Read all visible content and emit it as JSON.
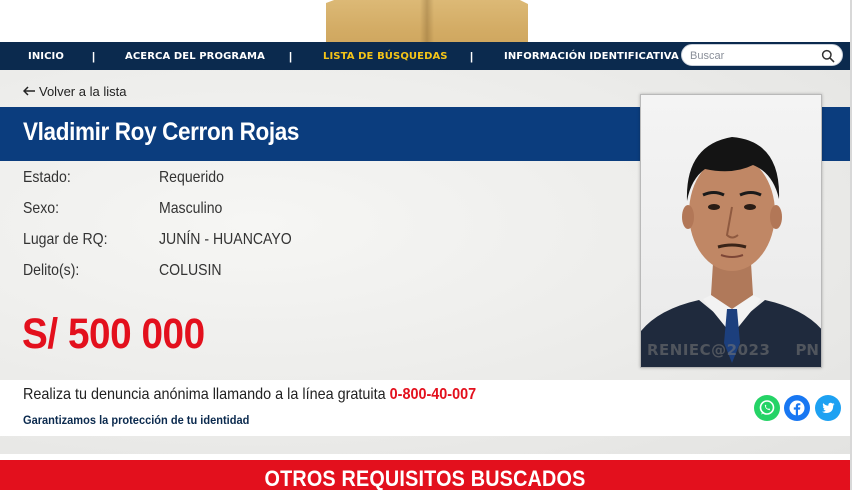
{
  "nav": {
    "items": [
      {
        "label": "INICIO"
      },
      {
        "label": "ACERCA DEL PROGRAMA"
      },
      {
        "label": "LISTA DE BÚSQUEDAS"
      },
      {
        "label": "INFORMACIÓN IDENTIFICATIVA"
      }
    ],
    "separator": "|",
    "active_item": "LISTA DE BÚSQUEDAS",
    "active_color": "#f5c518",
    "background_color": "#0b2a4e"
  },
  "search": {
    "placeholder": "Buscar",
    "value": "",
    "icon": "search-icon"
  },
  "back_link": {
    "label": "Volver a la lista",
    "icon": "arrow-left-icon"
  },
  "person": {
    "name": "Vladimir Roy Cerron Rojas",
    "fields": [
      {
        "label": "Estado:",
        "value": "Requerido"
      },
      {
        "label": "Sexo:",
        "value": "Masculino"
      },
      {
        "label": "Lugar de RQ:",
        "value": "JUNÍN - HUANCAYO"
      },
      {
        "label": "Delito(s):",
        "value": "COLUSIN"
      }
    ],
    "reward": "S/ 500 000",
    "photo_watermark": "RENIEC@2023",
    "photo_watermark_2": "PN"
  },
  "notice": {
    "text_before": "Realiza tu denuncia anónima llamando a la línea gratuita ",
    "hotline": "0-800-40-007",
    "subtext": "Garantizamos la protección de tu identidad"
  },
  "share": {
    "buttons": [
      {
        "name": "whatsapp",
        "color": "#25d366",
        "icon": "whatsapp-icon"
      },
      {
        "name": "facebook",
        "color": "#1877f2",
        "icon": "facebook-icon"
      },
      {
        "name": "twitter",
        "color": "#1da1f2",
        "icon": "twitter-icon"
      }
    ]
  },
  "footer": {
    "heading": "OTROS REQUISITOS BUSCADOS"
  },
  "colors": {
    "title_band": "#0b3d7e",
    "reward": "#e3101d",
    "footer_band": "#e3101d"
  }
}
